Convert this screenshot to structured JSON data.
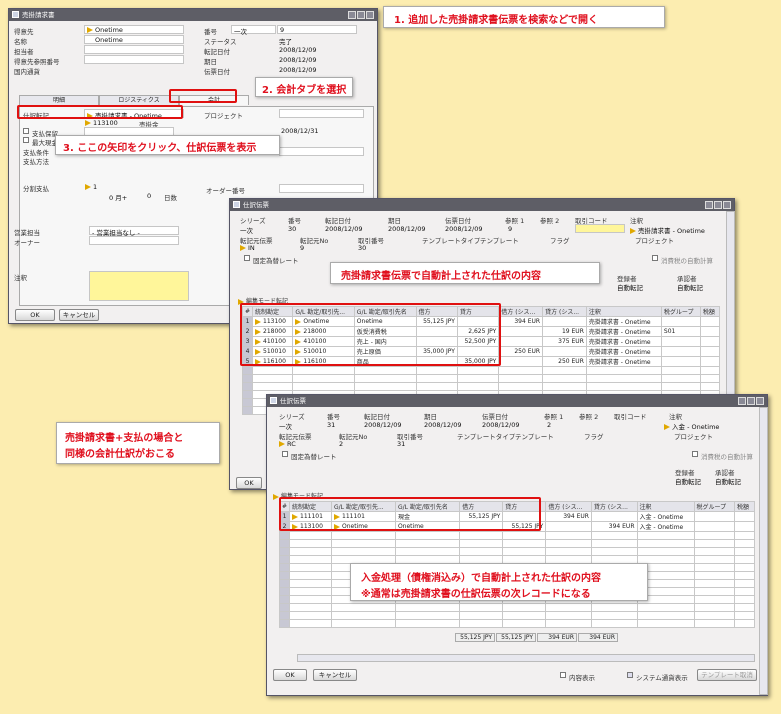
{
  "annotations": {
    "step1": "1. 追加した売掛請求書伝票を検索などで開く",
    "step2": "2. 会計タブを選択",
    "step3": "3. ここの矢印をクリック、仕訳伝票を表示",
    "auto_je": "売掛請求書伝票で自動計上された仕訳の内容",
    "same_je_line1": "売掛請求書+支払の場合と",
    "same_je_line2": "同様の会計仕訳がおこる",
    "payment_je_line1": "入金処理（債権消込み）で自動計上された仕訳の内容",
    "payment_je_line2": "※通常は売掛請求書の仕訳伝票の次レコードになる"
  },
  "invoice": {
    "title": "売掛請求書",
    "fields_left": [
      {
        "label": "得意先",
        "value": "Onetime"
      },
      {
        "label": "名称",
        "value": "Onetime"
      },
      {
        "label": "担当者",
        "value": ""
      },
      {
        "label": "得意先参照番号",
        "value": ""
      },
      {
        "label": "国内通貨",
        "value": ""
      }
    ],
    "fields_right": [
      {
        "label": "番号",
        "value": "9",
        "series": "一次"
      },
      {
        "label": "ステータス",
        "value": "完了"
      },
      {
        "label": "転記日付",
        "value": "2008/12/09"
      },
      {
        "label": "期日",
        "value": "2008/12/09"
      },
      {
        "label": "伝票日付",
        "value": "2008/12/09"
      }
    ],
    "tabs": [
      "明細",
      "ロジスティクス",
      "会計"
    ],
    "journal_label": "仕訳転記",
    "journal_value": "売掛請求書 - Onetime",
    "account_code": "113100",
    "account_label": "売掛金",
    "project_label": "プロジェクト",
    "pay_block": "支払保留",
    "max_cash": "最大現金",
    "pay_terms": "支払条件",
    "pay_method": "支払方法",
    "due_date_value": "2008/12/31",
    "installment": "分割支払",
    "installment_value": "1",
    "months_label": "0 月+",
    "days_value": "0",
    "days_label": "日数",
    "order_number": "オーダー番号",
    "sales_emp": "営業担当",
    "sales_emp_value": "- 営業担当なし -",
    "owner": "オーナー",
    "remarks": "注釈",
    "ok": "OK",
    "cancel": "キャンセル"
  },
  "je1": {
    "title": "仕訳伝票",
    "headers": [
      "シリーズ",
      "番号",
      "転記日付",
      "期日",
      "伝票日付",
      "参照 1",
      "参照 2",
      "取引コード",
      "注釈"
    ],
    "values": [
      "一次",
      "30",
      "2008/12/09",
      "2008/12/09",
      "2008/12/09",
      "9",
      "",
      "",
      "売掛請求書 - Onetime"
    ],
    "row2_labels": [
      "転記元伝票",
      "転記元No",
      "取引番号",
      "テンプレートタイプ",
      "テンプレート",
      "フラグ",
      "プロジェクト"
    ],
    "row2_values": [
      "IN",
      "9",
      "30"
    ],
    "fixed_rate": "固定為替レート",
    "adjust": "消費税の自動計算",
    "registrant": "登録者",
    "approver": "承認者",
    "registrant_value": "自動転記",
    "approver_value": "自動転記",
    "edit_mode": "編集モード転記",
    "columns": [
      "#",
      "統制勘定",
      "G/L 勘定/取引先...",
      "G/L 勘定/取引先名",
      "借方",
      "貸方",
      "借方 (シス...",
      "貸方 (シス...",
      "注釈",
      "税グループ",
      "税額"
    ],
    "rows": [
      [
        "1",
        "113100",
        "Onetime",
        "Onetime",
        "55,125 JPY",
        "",
        "394 EUR",
        "",
        "売掛請求書 - Onetime",
        "",
        ""
      ],
      [
        "2",
        "218000",
        "218000",
        "仮受消費税",
        "",
        "2,625 JPY",
        "",
        "19 EUR",
        "売掛請求書 - Onetime",
        "S01",
        ""
      ],
      [
        "3",
        "410100",
        "410100",
        "売上 - 国内",
        "",
        "52,500 JPY",
        "",
        "375 EUR",
        "売掛請求書 - Onetime",
        "",
        ""
      ],
      [
        "4",
        "510010",
        "510010",
        "売上原価",
        "35,000 JPY",
        "",
        "250 EUR",
        "",
        "売掛請求書 - Onetime",
        "",
        ""
      ],
      [
        "5",
        "116100",
        "116100",
        "商品",
        "",
        "35,000 JPY",
        "",
        "250 EUR",
        "売掛請求書 - Onetime",
        "",
        ""
      ]
    ]
  },
  "je2": {
    "title": "仕訳伝票",
    "headers": [
      "シリーズ",
      "番号",
      "転記日付",
      "期日",
      "伝票日付",
      "参照 1",
      "参照 2",
      "取引コード",
      "注釈"
    ],
    "values": [
      "一次",
      "31",
      "2008/12/09",
      "2008/12/09",
      "2008/12/09",
      "2",
      "",
      "",
      "入金 - Onetime"
    ],
    "row2_labels": [
      "転記元伝票",
      "転記元No",
      "取引番号",
      "テンプレートタイプ",
      "テンプレート",
      "フラグ",
      "プロジェクト"
    ],
    "row2_values": [
      "RC",
      "2",
      "31"
    ],
    "fixed_rate": "固定為替レート",
    "adjust": "消費税の自動計算",
    "registrant": "登録者",
    "approver": "承認者",
    "registrant_value": "自動転記",
    "approver_value": "自動転記",
    "edit_mode": "編集モード転記",
    "columns": [
      "#",
      "統制勘定",
      "G/L 勘定/取引先...",
      "G/L 勘定/取引先名",
      "借方",
      "貸方",
      "借方 (シス...",
      "貸方 (シス...",
      "注釈",
      "税グループ",
      "税額"
    ],
    "rows": [
      [
        "1",
        "111101",
        "111101",
        "現金",
        "55,125 JPY",
        "",
        "394 EUR",
        "",
        "入金 - Onetime",
        "",
        ""
      ],
      [
        "2",
        "113100",
        "Onetime",
        "Onetime",
        "",
        "55,125 JPY",
        "",
        "394 EUR",
        "入金 - Onetime",
        "",
        ""
      ]
    ],
    "totals": [
      "55,125 JPY",
      "55,125 JPY",
      "394 EUR",
      "394 EUR"
    ],
    "ok": "OK",
    "cancel": "キャンセル",
    "hide_sub": "内容表示",
    "sys_currency": "システム通貨表示",
    "template_btn": "テンプレート取消"
  }
}
